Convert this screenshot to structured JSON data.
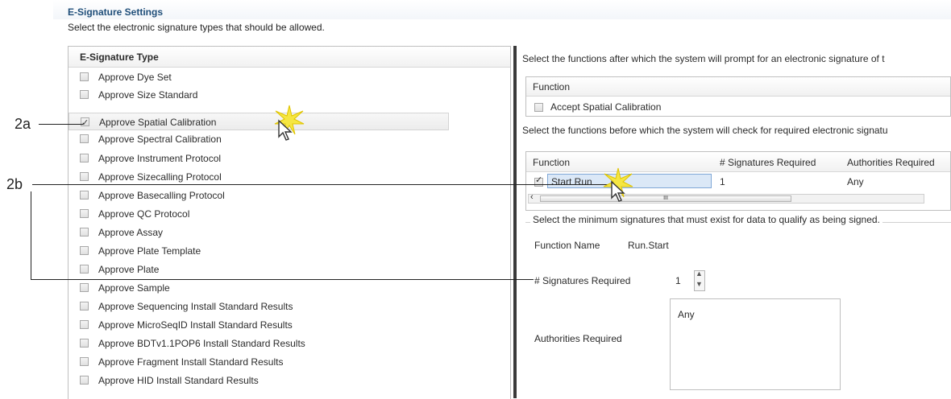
{
  "header": {
    "title": "E-Signature Settings",
    "subtitle": "Select the electronic signature types that should be allowed."
  },
  "left_panel": {
    "column_header": "E-Signature Type",
    "items": [
      {
        "label": "Approve Dye Set",
        "checked": false
      },
      {
        "label": "Approve Size Standard",
        "checked": false
      },
      {
        "label": "Approve Spatial Calibration",
        "checked": true
      },
      {
        "label": "Approve Spectral Calibration",
        "checked": false
      },
      {
        "label": "Approve Instrument Protocol",
        "checked": false
      },
      {
        "label": "Approve Sizecalling Protocol",
        "checked": false
      },
      {
        "label": "Approve Basecalling Protocol",
        "checked": false
      },
      {
        "label": "Approve QC Protocol",
        "checked": false
      },
      {
        "label": "Approve Assay",
        "checked": false
      },
      {
        "label": "Approve Plate Template",
        "checked": false
      },
      {
        "label": "Approve Plate",
        "checked": false
      },
      {
        "label": "Approve Sample",
        "checked": false
      },
      {
        "label": "Approve Sequencing Install Standard Results",
        "checked": false
      },
      {
        "label": "Approve MicroSeqID Install Standard Results",
        "checked": false
      },
      {
        "label": "Approve BDTv1.1POP6 Install Standard Results",
        "checked": false
      },
      {
        "label": "Approve Fragment Install Standard Results",
        "checked": false
      },
      {
        "label": "Approve HID Install Standard Results",
        "checked": false
      }
    ]
  },
  "right_panel": {
    "after_prompt": "Select the functions after which the system will prompt for an electronic signature of t",
    "after_table": {
      "header": "Function",
      "row": {
        "label": "Accept Spatial Calibration",
        "checked": false
      }
    },
    "before_prompt": "Select the functions before which the system will check for required electronic signatu",
    "before_table": {
      "headers": [
        "Function",
        "# Signatures Required",
        "Authorities Required"
      ],
      "row": {
        "function": "Start Run",
        "signatures": "1",
        "authorities": "Any",
        "checked": true
      },
      "scroll_left": "‹",
      "scroll_thumb": "III"
    },
    "minimum_legend": "Select the minimum signatures that must exist for data to qualify as being signed.",
    "function_name_label": "Function Name",
    "function_name_value": "Run.Start",
    "signatures_label": "# Signatures Required",
    "signatures_value": "1",
    "authorities_label": "Authorities Required",
    "authorities_list": [
      "Any"
    ]
  },
  "annotations": {
    "a": "2a",
    "b": "2b"
  },
  "colors": {
    "title": "#1f4e79",
    "highlight_star": "#f5e642",
    "selected_field": "#dbe8f7"
  }
}
